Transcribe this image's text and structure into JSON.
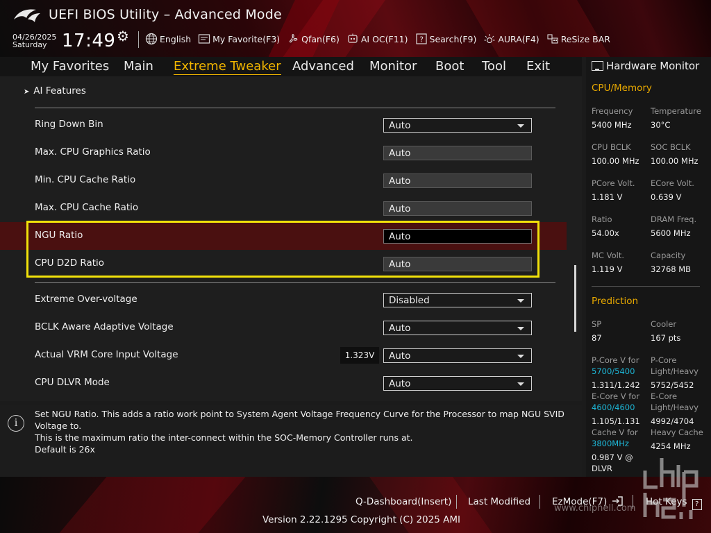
{
  "header": {
    "title": "UEFI BIOS Utility – Advanced Mode",
    "date": "04/26/2025",
    "day": "Saturday",
    "time": "17:49",
    "tools": [
      {
        "label": "English",
        "icon": "globe-icon"
      },
      {
        "label": "My Favorite(F3)",
        "icon": "favorite-icon"
      },
      {
        "label": "Qfan(F6)",
        "icon": "fan-icon"
      },
      {
        "label": "AI OC(F11)",
        "icon": "ai-oc-icon"
      },
      {
        "label": "Search(F9)",
        "icon": "search-icon"
      },
      {
        "label": "AURA(F4)",
        "icon": "aura-icon"
      },
      {
        "label": "ReSize BAR",
        "icon": "resize-bar-icon"
      }
    ]
  },
  "tabs": [
    "My Favorites",
    "Main",
    "Extreme Tweaker",
    "Advanced",
    "Monitor",
    "Boot",
    "Tool",
    "Exit"
  ],
  "active_tab": "Extreme Tweaker",
  "submenu": "AI Features",
  "settings": [
    {
      "label": "Ring Down Bin",
      "value": "Auto",
      "kind": "dropdown"
    },
    {
      "label": "Max. CPU Graphics Ratio",
      "value": "Auto",
      "kind": "text"
    },
    {
      "label": "Min. CPU Cache Ratio",
      "value": "Auto",
      "kind": "text"
    },
    {
      "label": "Max. CPU Cache Ratio",
      "value": "Auto",
      "kind": "text"
    },
    {
      "label": "NGU Ratio",
      "value": "Auto",
      "kind": "text-active"
    },
    {
      "label": "CPU D2D Ratio",
      "value": "Auto",
      "kind": "text"
    },
    {
      "label": "Extreme Over-voltage",
      "value": "Disabled",
      "kind": "dropdown"
    },
    {
      "label": "BCLK Aware Adaptive Voltage",
      "value": "Auto",
      "kind": "dropdown"
    },
    {
      "label": "Actual VRM Core Input Voltage",
      "value": "Auto",
      "kind": "dropdown",
      "tag": "1.323V"
    },
    {
      "label": "CPU DLVR Mode",
      "value": "Auto",
      "kind": "dropdown"
    }
  ],
  "help": {
    "line1": "Set NGU Ratio. This adds a ratio work point to System Agent Voltage Frequency Curve for the Processor to map NGU SVID Voltage to.",
    "line2": "This is the maximum ratio the inter-connect within the SOC-Memory Controller runs at.",
    "line3": "Default is 26x"
  },
  "hardware_monitor": {
    "title": "Hardware Monitor",
    "cpu_memory": {
      "heading": "CPU/Memory",
      "items": [
        {
          "k": "Frequency",
          "v": "5400 MHz"
        },
        {
          "k": "Temperature",
          "v": "30°C"
        },
        {
          "k": "CPU BCLK",
          "v": "100.00 MHz"
        },
        {
          "k": "SOC BCLK",
          "v": "100.00 MHz"
        },
        {
          "k": "PCore Volt.",
          "v": "1.181 V"
        },
        {
          "k": "ECore Volt.",
          "v": "0.639 V"
        },
        {
          "k": "Ratio",
          "v": "54.00x"
        },
        {
          "k": "DRAM Freq.",
          "v": "5600 MHz"
        },
        {
          "k": "MC Volt.",
          "v": "1.119 V"
        },
        {
          "k": "Capacity",
          "v": "32768 MB"
        }
      ]
    },
    "prediction": {
      "heading": "Prediction",
      "sp_label": "SP",
      "sp_value": "87",
      "cooler_label": "Cooler",
      "cooler_value": "167 pts",
      "pcore_label": "P-Core V for",
      "pcore_freq": "5700/5400",
      "pcore_value": "1.311/1.242",
      "pcore_lh_label1": "P-Core",
      "pcore_lh_label2": "Light/Heavy",
      "pcore_lh_value": "5752/5452",
      "ecore_label": "E-Core V for",
      "ecore_freq": "4600/4600",
      "ecore_value": "1.105/1.131",
      "ecore_lh_label1": "E-Core",
      "ecore_lh_label2": "Light/Heavy",
      "ecore_lh_value": "4992/4704",
      "cache_label": "Cache V for",
      "cache_freq": "3800MHz",
      "cache_value1": "0.987 V @",
      "cache_value2": "DLVR",
      "heavy_cache_label": "Heavy Cache",
      "heavy_cache_value": "4254 MHz"
    }
  },
  "footer": {
    "qdashboard": "Q-Dashboard(Insert)",
    "last_modified": "Last Modified",
    "ezmode": "EzMode(F7)",
    "hotkeys": "Hot Keys",
    "hotkeys_box": "?",
    "version": "Version 2.22.1295 Copyright (C) 2025 AMI",
    "watermark": "www.chiphell.com"
  },
  "colors": {
    "accent": "#f0b400",
    "section": "#e7a800",
    "highlight_box": "#f2e20a",
    "selected_row": "#4a1010",
    "link_blue": "#1db6d6"
  }
}
